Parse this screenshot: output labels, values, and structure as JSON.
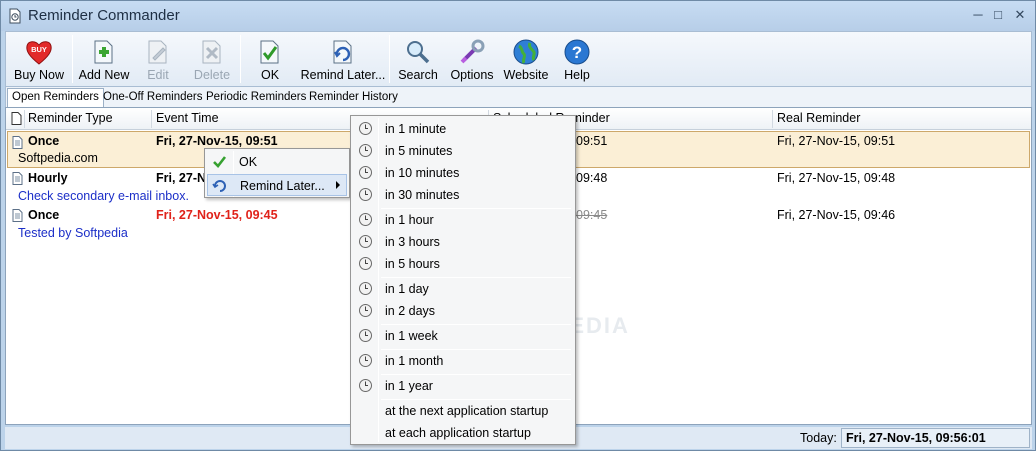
{
  "window": {
    "title": "Reminder Commander"
  },
  "toolbar": {
    "buy_now": "Buy Now",
    "buy_badge": "BUY",
    "add_new": "Add New",
    "edit": "Edit",
    "delete": "Delete",
    "ok": "OK",
    "remind_later": "Remind Later...",
    "search": "Search",
    "options": "Options",
    "website": "Website",
    "help": "Help"
  },
  "tabs": [
    "Open Reminders",
    "One-Off Reminders",
    "Periodic Reminders",
    "Reminder History"
  ],
  "grid": {
    "columns": [
      "Reminder Type",
      "Event Time",
      "Scheduled Reminder",
      "Real Reminder"
    ],
    "rows": [
      {
        "type": "Once",
        "event_time": "Fri, 27-Nov-15, 09:51",
        "scheduled": "09:51",
        "real": "Fri, 27-Nov-15, 09:51",
        "note": "Softpedia.com"
      },
      {
        "type": "Hourly",
        "event_time": "Fri, 27-N",
        "scheduled": "09:48",
        "real": "Fri, 27-Nov-15, 09:48",
        "note": "Check secondary e-mail inbox."
      },
      {
        "type": "Once",
        "event_time": "Fri, 27-Nov-15, 09:45",
        "scheduled": "09:45",
        "real": "Fri, 27-Nov-15, 09:46",
        "note": "Tested by Softpedia"
      }
    ]
  },
  "context_menu": {
    "ok": "OK",
    "remind_later": "Remind Later..."
  },
  "remind_submenu": {
    "items": [
      "in 1 minute",
      "in 5 minutes",
      "in 10 minutes",
      "in 30 minutes",
      "in 1 hour",
      "in 3 hours",
      "in 5 hours",
      "in 1 day",
      "in 2 days",
      "in 1 week",
      "in 1 month",
      "in 1 year",
      "at the next application startup",
      "at each application startup"
    ]
  },
  "status": {
    "today_label": "Today:",
    "today_value": "Fri, 27-Nov-15, 09:56:01"
  },
  "watermark": "SOFTPEDIA"
}
